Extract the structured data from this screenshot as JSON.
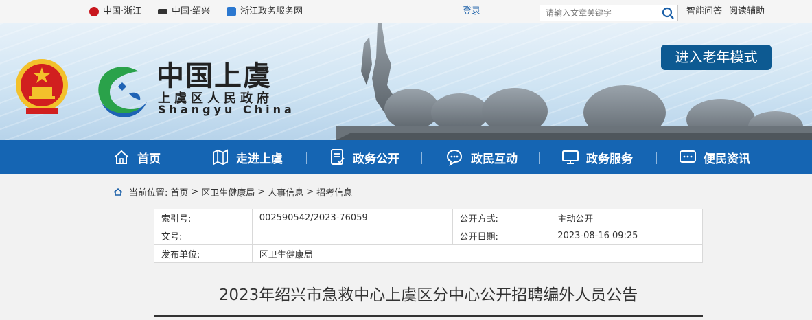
{
  "topbar": {
    "links": [
      "中国·浙江",
      "中国·绍兴",
      "浙江政务服务网"
    ],
    "login": "登录",
    "search_placeholder": "请输入文章关键字",
    "right_links": [
      "智能问答",
      "阅读辅助"
    ]
  },
  "banner": {
    "title": "中国上虞",
    "subtitle": "上虞区人民政府",
    "english": "Shangyu China",
    "elder_mode": "进入老年模式"
  },
  "nav": {
    "items": [
      "首页",
      "走进上虞",
      "政务公开",
      "政民互动",
      "政务服务",
      "便民资讯"
    ]
  },
  "breadcrumb": {
    "label": "当前位置:",
    "items": [
      "首页",
      "区卫生健康局",
      "人事信息",
      "招考信息"
    ]
  },
  "info": {
    "index_label": "索引号:",
    "index_value": "002590542/2023-76059",
    "method_label": "公开方式:",
    "method_value": "主动公开",
    "doc_label": "文号:",
    "doc_value": "",
    "date_label": "公开日期:",
    "date_value": "2023-08-16 09:25",
    "issuer_label": "发布单位:",
    "issuer_value": "区卫生健康局"
  },
  "article": {
    "title": "2023年绍兴市急救中心上虞区分中心公开招聘编外人员公告"
  },
  "colors": {
    "nav_bg": "#1565b3",
    "elder_btn": "#0d5a92",
    "link_blue": "#1a5fa8"
  }
}
